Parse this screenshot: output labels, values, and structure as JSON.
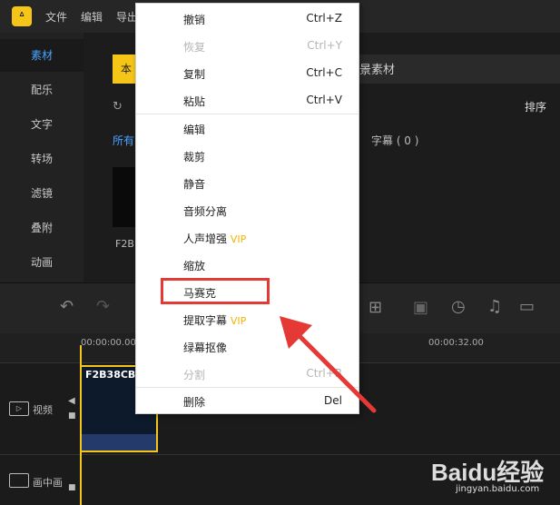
{
  "topbar": {
    "logo": "ᐞ",
    "menu": [
      "文件",
      "编辑",
      "导出"
    ]
  },
  "sidebar": {
    "items": [
      "素材",
      "配乐",
      "文字",
      "转场",
      "滤镜",
      "叠附",
      "动画"
    ]
  },
  "panel": {
    "tab_active": "本",
    "scene": "场景素材",
    "sort": "排序",
    "filter_all": "所有",
    "subtitles": "字幕 ( 0 )",
    "thumb_label": "F2B"
  },
  "timeline": {
    "time_start": "00:00:00.00",
    "time_mark": "00:00:32.00",
    "tracks": [
      "视频",
      "画中画"
    ],
    "clip_title": "F2B38CB"
  },
  "context_menu": {
    "items": [
      {
        "label": "撤销",
        "shortcut": "Ctrl+Z",
        "disabled": false
      },
      {
        "label": "恢复",
        "shortcut": "Ctrl+Y",
        "disabled": true
      },
      {
        "label": "复制",
        "shortcut": "Ctrl+C",
        "disabled": false
      },
      {
        "label": "粘贴",
        "shortcut": "Ctrl+V",
        "disabled": false
      },
      {
        "label": "编辑",
        "shortcut": "",
        "disabled": false
      },
      {
        "label": "裁剪",
        "shortcut": "",
        "disabled": false
      },
      {
        "label": "静音",
        "shortcut": "",
        "disabled": false
      },
      {
        "label": "音频分离",
        "shortcut": "",
        "disabled": false
      },
      {
        "label": "人声增强",
        "shortcut": "",
        "disabled": false,
        "badge": "VIP"
      },
      {
        "label": "缩放",
        "shortcut": "",
        "disabled": false
      },
      {
        "label": "马赛克",
        "shortcut": "",
        "disabled": false
      },
      {
        "label": "提取字幕",
        "shortcut": "",
        "disabled": false,
        "badge": "VIP"
      },
      {
        "label": "绿幕抠像",
        "shortcut": "",
        "disabled": false
      },
      {
        "label": "分割",
        "shortcut": "Ctrl+B",
        "disabled": true
      },
      {
        "label": "删除",
        "shortcut": "Del",
        "disabled": false
      }
    ]
  },
  "watermark": {
    "brand": "Baidu经验",
    "url": "jingyan.baidu.com"
  },
  "colors": {
    "accent": "#f5c518",
    "highlight": "#e53935",
    "link": "#4aa3ff"
  }
}
